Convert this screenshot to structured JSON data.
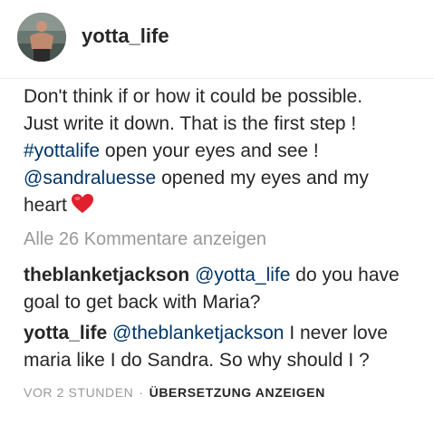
{
  "post": {
    "username": "yotta_life",
    "caption": {
      "line1": "Don't think if or how it could be possible.",
      "line2": "Just write it down. That is the first step !",
      "line3_hashtag": "#yottalife",
      "line3_rest": " open your eyes and see !",
      "line4_mention": "@sandraluesse",
      "line4_rest": " opened my eyes and my",
      "line5": "heart",
      "line5_emoji": "heart-icon"
    },
    "view_all_comments": "Alle 26 Kommentare anzeigen"
  },
  "comments": [
    {
      "username": "theblanketjackson",
      "mention": "@yotta_life",
      "line1_rest": " do you have",
      "line2": "goal to get back with Maria?"
    },
    {
      "username": "yotta_life",
      "mention": "@theblanketjackson",
      "line1_rest": " I never love",
      "line2": "maria like I do Sandra. So why should I ?"
    }
  ],
  "meta": {
    "time": "VOR 2 STUNDEN",
    "separator": "·",
    "translate_label": "ÜBERSETZUNG ANZEIGEN"
  },
  "colors": {
    "text": "#262626",
    "link": "#003569",
    "muted": "#999999",
    "heart": "#e0202d"
  }
}
